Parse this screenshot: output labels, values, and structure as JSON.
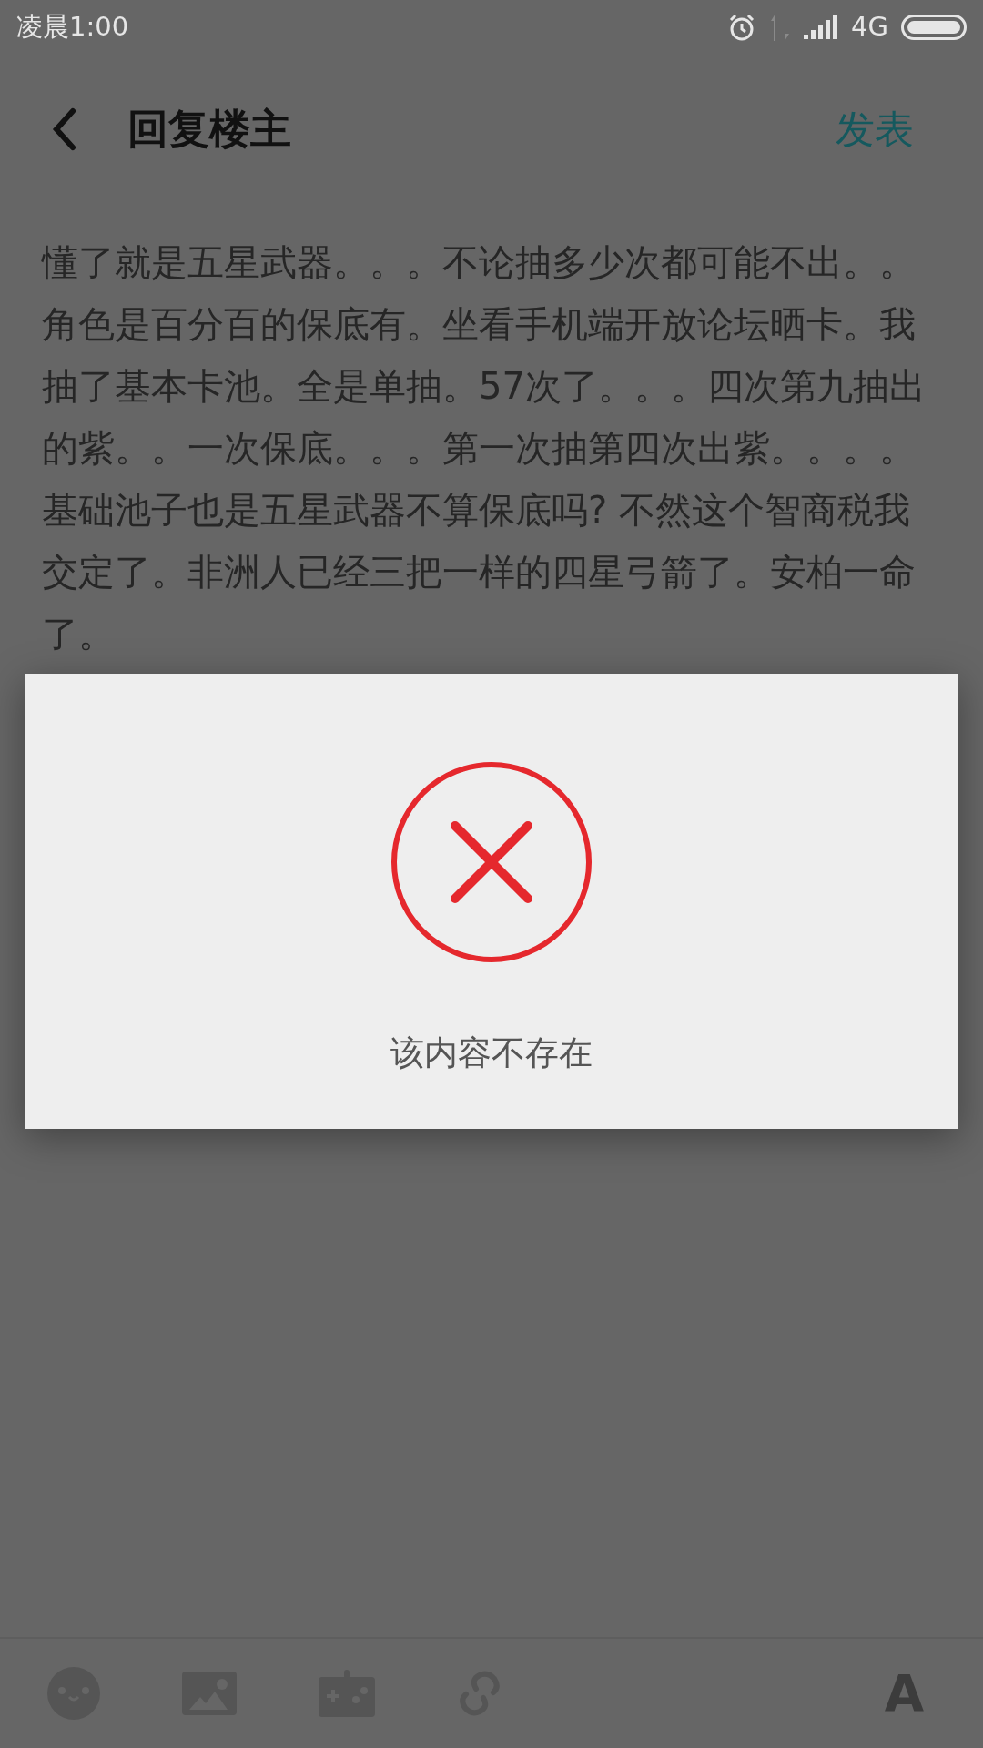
{
  "status_bar": {
    "time": "凌晨1:00",
    "network": "4G"
  },
  "header": {
    "title": "回复楼主",
    "action": "发表"
  },
  "post": {
    "body": "懂了就是五星武器。。。不论抽多少次都可能不出。。角色是百分百的保底有。坐看手机端开放论坛晒卡。我抽了基本卡池。全是单抽。57次了。。。四次第九抽出的紫。。一次保底。。。第一次抽第四次出紫。。。。基础池子也是五星武器不算保底吗? 不然这个智商税我交定了。非洲人已经三把一样的四星弓箭了。安柏一命了。"
  },
  "dialog": {
    "kind": "error",
    "message": "该内容不存在"
  },
  "toolbar": {
    "font_button": "A"
  }
}
